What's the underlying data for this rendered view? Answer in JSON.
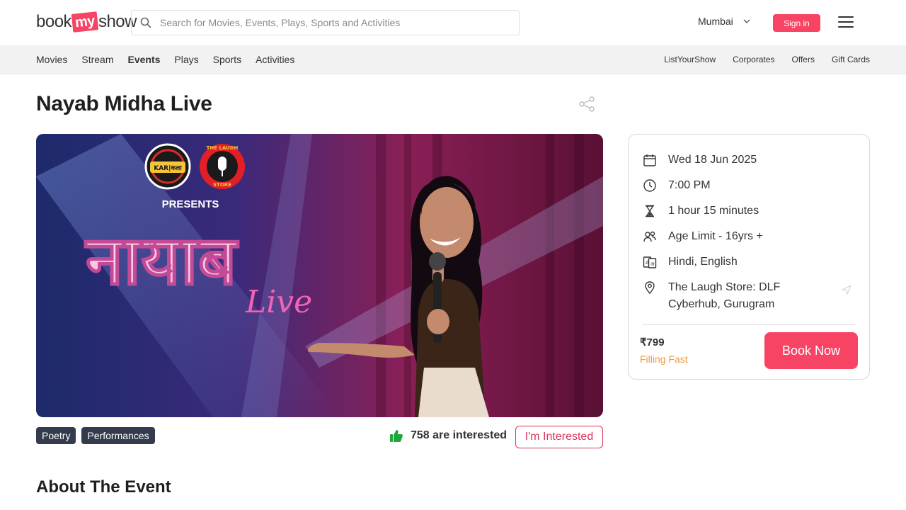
{
  "header": {
    "logo_part1": "book",
    "logo_part2": "my",
    "logo_part3": "show",
    "search_placeholder": "Search for Movies, Events, Plays, Sports and Activities",
    "city": "Mumbai",
    "signin_label": "Sign in"
  },
  "nav": {
    "left": [
      "Movies",
      "Stream",
      "Events",
      "Plays",
      "Sports",
      "Activities"
    ],
    "active": "Events",
    "right": [
      "ListYourShow",
      "Corporates",
      "Offers",
      "Gift Cards"
    ]
  },
  "event": {
    "title": "Nayab Midha Live",
    "banner": {
      "logo1": "KAR|कला",
      "logo2_top": "THE LAUGH",
      "logo2_bottom": "STORE",
      "presents": "PRESENTS",
      "hindi_title": "नायाब",
      "live_script": "Live"
    },
    "tags": [
      "Poetry",
      "Performances"
    ],
    "interested_count": "758 are interested",
    "interested_button": "I'm Interested",
    "about_heading": "About The Event"
  },
  "details": {
    "date": "Wed 18 Jun 2025",
    "time": "7:00 PM",
    "duration": "1 hour 15 minutes",
    "age_limit": "Age Limit - 16yrs +",
    "languages": "Hindi, English",
    "venue": "The Laugh Store: DLF Cyberhub, Gurugram",
    "price": "₹799",
    "availability": "Filling Fast",
    "book_button": "Book Now"
  },
  "colors": {
    "brand": "#f84464",
    "accent_red": "#dc3558",
    "tag_bg": "#333b4d",
    "filling_fast": "#f09a3e",
    "thumb_green": "#1ea83c"
  }
}
